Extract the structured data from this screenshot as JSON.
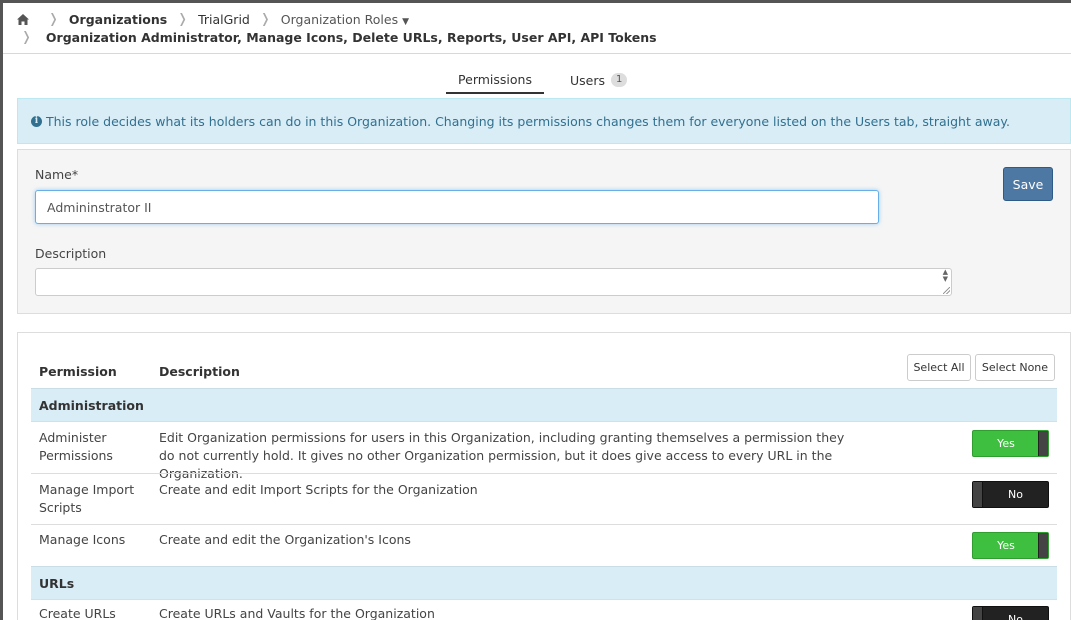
{
  "breadcrumb": {
    "home_icon": "home-icon",
    "organizations": "Organizations",
    "org_name": "TrialGrid",
    "roles": "Organization Roles",
    "current": "Organization Administrator, Manage Icons, Delete URLs, Reports, User API, API Tokens"
  },
  "tabs": {
    "permissions": "Permissions",
    "users": "Users",
    "users_count": "1"
  },
  "alert": {
    "icon": "info-icon",
    "text": "This role decides what its holders can do in this Organization. Changing its permissions changes them for everyone listed on the Users tab, straight away."
  },
  "form": {
    "name_label": "Name*",
    "name_value": "Admininstrator II",
    "description_label": "Description",
    "description_value": "",
    "save_label": "Save"
  },
  "permissions": {
    "select_all": "Select All",
    "select_none": "Select None",
    "headers": {
      "permission": "Permission",
      "description": "Description"
    },
    "groups": [
      {
        "name": "Administration",
        "items": [
          {
            "name": "Administer Permissions",
            "description": "Edit Organization permissions for users in this Organization, including granting themselves a permission they do not currently hold. It gives no other Organization permission, but it does give access to every URL in the Organization.",
            "state": "Yes"
          },
          {
            "name": "Manage Import Scripts",
            "description": "Create and edit Import Scripts for the Organization",
            "state": "No"
          },
          {
            "name": "Manage Icons",
            "description": "Create and edit the Organization's Icons",
            "state": "Yes"
          }
        ]
      },
      {
        "name": "URLs",
        "items": [
          {
            "name": "Create URLs",
            "description": "Create URLs and Vaults for the Organization",
            "state": "No"
          }
        ]
      }
    ]
  },
  "colors": {
    "toggle_yes": "#3fbf3f",
    "toggle_no": "#222222",
    "save": "#4d78a3",
    "info_bg": "#d9edf7"
  }
}
